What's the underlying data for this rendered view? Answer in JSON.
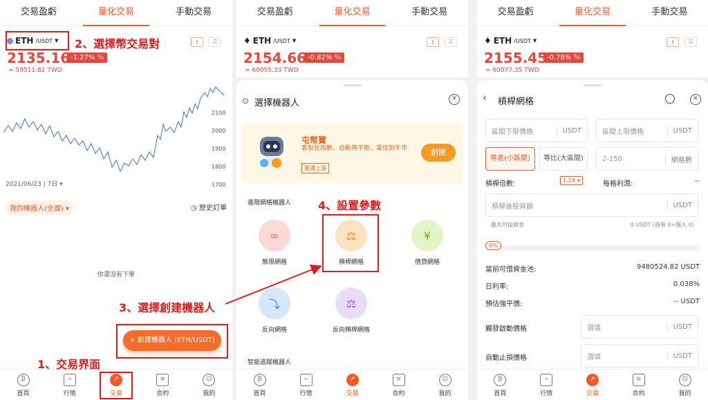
{
  "tabs": [
    "交易盈虧",
    "量化交易",
    "手動交易"
  ],
  "active_tab_index": 1,
  "pair": {
    "base": "ETH",
    "quote": "/USDT"
  },
  "screen1": {
    "price": "2135.16",
    "change": "-1.27%",
    "twd": "≈ 59511.82 TWD",
    "chart_date": "2021/06/23 | 7日",
    "y_ticks": [
      "2100",
      "2000",
      "1900",
      "1800",
      "1700"
    ],
    "robots_filter": "我的機器人(全部)",
    "history": "歷史訂單",
    "no_order": "你還沒有下單",
    "create_button": "創建機器人 (ETH/USDT)"
  },
  "screen2": {
    "price": "2154.66",
    "change": "-0.82%",
    "twd": "≈ 60055.33 TWD",
    "sheet_title": "選擇機器人",
    "promo": {
      "title": "屯幣寶",
      "subtitle": "客製化指數，自動再平衡，拿住到牛市",
      "tag": "震盪上漲",
      "button": "創建"
    },
    "section_advanced": "進階網格機器人",
    "bots": [
      {
        "label": "無限網格",
        "color": "#fcd8d6",
        "glyph": "∞"
      },
      {
        "label": "槓桿網格",
        "color": "#fbe3c1",
        "glyph": "⚖"
      },
      {
        "label": "借貸網格",
        "color": "#e2f5c4",
        "glyph": "¥"
      },
      {
        "label": "反向網格",
        "color": "#d6e6fb",
        "glyph": "📉"
      },
      {
        "label": "反向槓桿網格",
        "color": "#e9dcf7",
        "glyph": "⚖"
      }
    ],
    "section_smart": "智能追蹤機器人"
  },
  "screen3": {
    "price": "2155.45",
    "change": "-0.78%",
    "twd": "≈ 60077.35 TWD",
    "title": "槓桿網格",
    "lower_price": "區間下限價格",
    "upper_price": "區間上限價格",
    "unit_usdt": "USDT",
    "seg_equal_diff": "等差(小區間)",
    "seg_equal_ratio": "等比(大區間)",
    "grid_count_placeholder": "2-150",
    "grid_count_unit": "網格數",
    "leverage_label": "槓桿倍數:",
    "leverage_value": "1.2X",
    "grid_profit_label": "每格利潤:",
    "grid_profit_value": "--",
    "invest_placeholder": "槓桿後投資額",
    "max_invest_label": "最大可投資金",
    "max_invest_value": "0 USDT (自有 0+借入 0)",
    "progress_label": "0%",
    "progress_value": 0,
    "pool_label": "當前可借資金池:",
    "pool_value": "9480524.82 USDT",
    "rate_label": "日利率:",
    "rate_value": "0.038%",
    "liq_label": "預估強平價:",
    "liq_value": "-- USDT",
    "trigger_label": "觸發啟動價格",
    "stoploss_label": "自動止損價格",
    "optional": "選填"
  },
  "bottom_nav": [
    "首頁",
    "行情",
    "交易",
    "合約",
    "我的"
  ],
  "annotations": {
    "a1": "1、交易界面",
    "a2": "2、選擇幣交易對",
    "a3": "3、選擇創建機器人",
    "a4": "4、設置參數"
  },
  "colors": {
    "accent": "#f05a28",
    "down": "#e8453c",
    "annotation": "#d81e1e"
  }
}
